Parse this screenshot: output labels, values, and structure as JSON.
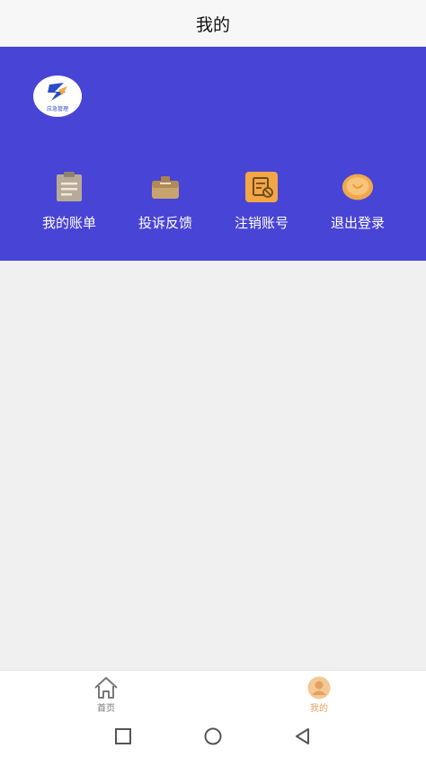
{
  "header": {
    "title": "我的"
  },
  "profile": {
    "logo_text": "应急管理"
  },
  "actions": [
    {
      "label": "我的账单",
      "icon": "clipboard-icon"
    },
    {
      "label": "投诉反馈",
      "icon": "briefcase-icon"
    },
    {
      "label": "注销账号",
      "icon": "cancel-account-icon"
    },
    {
      "label": "退出登录",
      "icon": "logout-coin-icon"
    }
  ],
  "tabbar": {
    "items": [
      {
        "label": "首页",
        "icon": "home-icon",
        "active": false
      },
      {
        "label": "我的",
        "icon": "user-icon",
        "active": true
      }
    ]
  },
  "system_nav": [
    "recent-apps-icon",
    "home-circle-icon",
    "back-icon"
  ],
  "colors": {
    "header_bg": "#4844d6",
    "page_bg": "#f0f0f0",
    "active_tab": "#e5a060",
    "inactive_tab": "#777777"
  }
}
